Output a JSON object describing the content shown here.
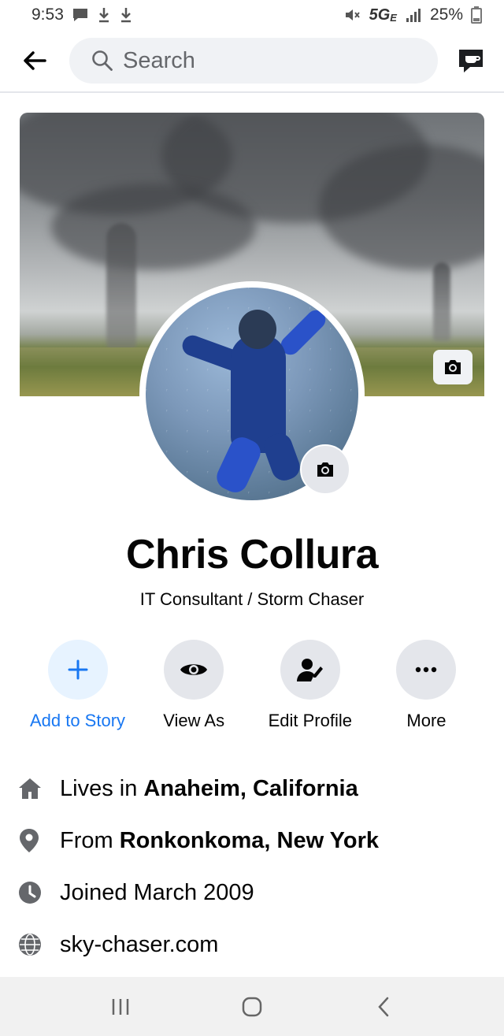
{
  "status_bar": {
    "time": "9:53",
    "network": "5G",
    "network_suffix": "E",
    "battery": "25%"
  },
  "top_bar": {
    "search_placeholder": "Search"
  },
  "profile": {
    "name": "Chris Collura",
    "bio": "IT Consultant / Storm Chaser"
  },
  "actions": [
    {
      "label": "Add to Story",
      "icon": "plus-icon"
    },
    {
      "label": "View As",
      "icon": "eye-icon"
    },
    {
      "label": "Edit Profile",
      "icon": "edit-profile-icon"
    },
    {
      "label": "More",
      "icon": "more-dots-icon"
    }
  ],
  "intro": {
    "lives_prefix": "Lives in ",
    "lives_place": "Anaheim, California",
    "from_prefix": "From ",
    "from_place": "Ronkonkoma, New York",
    "joined": "Joined March 2009",
    "website": "sky-chaser.com"
  },
  "colors": {
    "accent": "#1877f2",
    "icon_gray": "#65676b",
    "button_bg": "#e4e6eb"
  }
}
